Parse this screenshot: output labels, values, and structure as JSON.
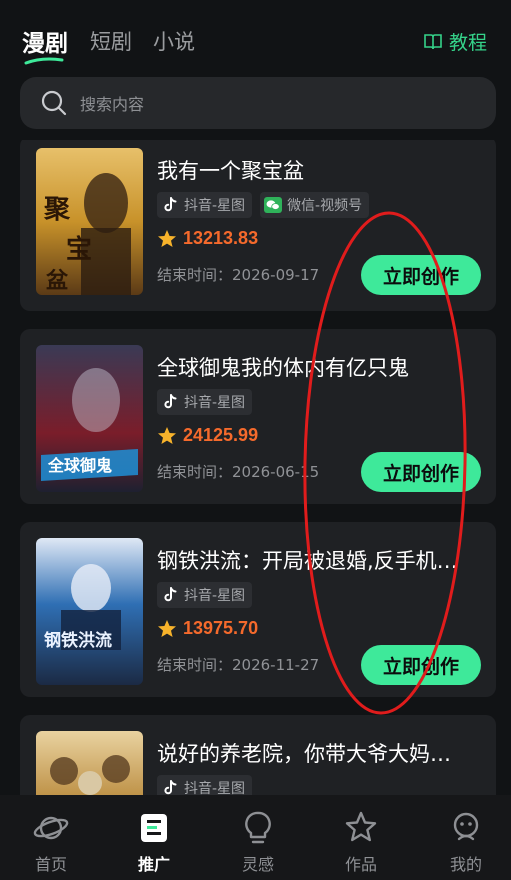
{
  "header": {
    "tabs": [
      "漫剧",
      "短剧",
      "小说"
    ],
    "active_tab": "漫剧",
    "tutorial_label": "教程"
  },
  "search": {
    "placeholder": "搜索内容"
  },
  "items": [
    {
      "title": "我有一个聚宝盆",
      "tags": [
        {
          "icon": "douyin-icon",
          "label": "抖音-星图"
        },
        {
          "icon": "wechat-icon",
          "label": "微信-视频号"
        }
      ],
      "score": "13213.83",
      "end_time": "结束时间：2026-09-17",
      "button": "立即创作",
      "cover_colors": [
        "#c8922a",
        "#5b3a16",
        "#e7c06a"
      ]
    },
    {
      "title": "全球御鬼我的体内有亿只鬼",
      "tags": [
        {
          "icon": "douyin-icon",
          "label": "抖音-星图"
        }
      ],
      "score": "24125.99",
      "end_time": "结束时间：2026-06-15",
      "button": "立即创作",
      "cover_colors": [
        "#3a3a55",
        "#7a1d2a",
        "#1e8fd6"
      ]
    },
    {
      "title": "钢铁洪流：开局被退婚,反手机…",
      "tags": [
        {
          "icon": "douyin-icon",
          "label": "抖音-星图"
        }
      ],
      "score": "13975.70",
      "end_time": "结束时间：2026-11-27",
      "button": "立即创作",
      "cover_colors": [
        "#1b2a44",
        "#2f6fb4",
        "#dfe8f5"
      ]
    },
    {
      "title": "说好的养老院，你带大爷大妈…",
      "tags": [
        {
          "icon": "douyin-icon",
          "label": "抖音-星图"
        }
      ],
      "cover_colors": [
        "#3a2a18",
        "#b98a3c",
        "#e9d2a0"
      ]
    }
  ],
  "tabbar": [
    {
      "icon": "planet-icon",
      "label": "首页"
    },
    {
      "icon": "promote-icon",
      "label": "推广",
      "active": true
    },
    {
      "icon": "bulb-icon",
      "label": "灵感"
    },
    {
      "icon": "star-icon",
      "label": "作品"
    },
    {
      "icon": "profile-icon",
      "label": "我的"
    }
  ],
  "colors": {
    "background": "#111315",
    "card": "#1f2124",
    "accent_green": "#3ee99a",
    "score_orange": "#f56a2c",
    "annotation_red": "#e01c1c"
  }
}
